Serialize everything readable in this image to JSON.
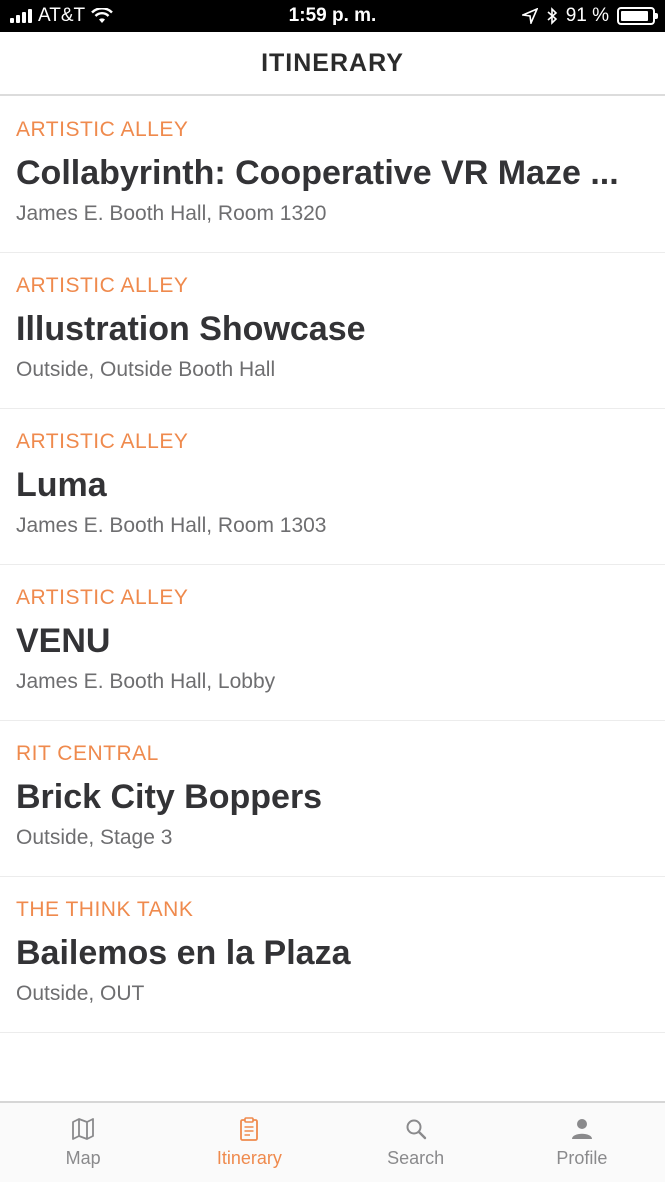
{
  "status_bar": {
    "carrier": "AT&T",
    "time": "1:59 p. m.",
    "battery": "91 %",
    "battery_level": 0.91
  },
  "header": {
    "title": "ITINERARY"
  },
  "items": [
    {
      "category": "ARTISTIC ALLEY",
      "title": "Collabyrinth: Cooperative VR Maze ...",
      "location": "James E. Booth Hall, Room 1320"
    },
    {
      "category": "ARTISTIC ALLEY",
      "title": "Illustration Showcase",
      "location": "Outside, Outside Booth Hall"
    },
    {
      "category": "ARTISTIC ALLEY",
      "title": "Luma",
      "location": "James E. Booth Hall, Room 1303"
    },
    {
      "category": "ARTISTIC ALLEY",
      "title": "VENU",
      "location": "James E. Booth Hall, Lobby"
    },
    {
      "category": "RIT CENTRAL",
      "title": "Brick City Boppers",
      "location": "Outside, Stage 3"
    },
    {
      "category": "THE THINK TANK",
      "title": "Bailemos en la Plaza",
      "location": "Outside, OUT"
    }
  ],
  "tabs": [
    {
      "label": "Map",
      "icon": "map-icon"
    },
    {
      "label": "Itinerary",
      "icon": "clipboard-icon",
      "active": true
    },
    {
      "label": "Search",
      "icon": "search-icon"
    },
    {
      "label": "Profile",
      "icon": "person-icon"
    }
  ],
  "colors": {
    "accent": "#ef8a4d",
    "text": "#333336",
    "secondary": "#6e6e70"
  }
}
